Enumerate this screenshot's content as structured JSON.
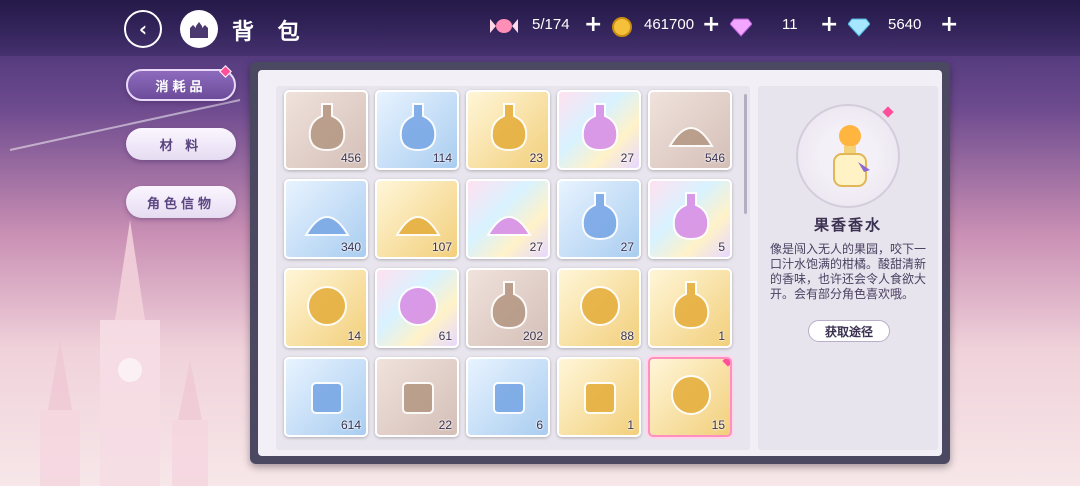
{
  "header": {
    "title": "背 包",
    "back_icon": "back-arrow-icon",
    "home_icon": "castle-icon"
  },
  "resources": [
    {
      "name": "candy",
      "icon": "candy-icon",
      "value": "5/174"
    },
    {
      "name": "coin",
      "icon": "gold-coin-icon",
      "value": "461700"
    },
    {
      "name": "pink-gem",
      "icon": "pink-diamond-icon",
      "value": "11"
    },
    {
      "name": "blue-gem",
      "icon": "blue-diamond-icon",
      "value": "5640"
    }
  ],
  "tabs": [
    {
      "label": "消耗品",
      "active": true
    },
    {
      "label": "材 料",
      "active": false
    },
    {
      "label": "角色信物",
      "active": false
    }
  ],
  "items": [
    {
      "icon": "green-potion-vial-icon",
      "count": "456",
      "rarity": "brown"
    },
    {
      "icon": "purple-sparkle-flask-icon",
      "count": "114",
      "rarity": "blue"
    },
    {
      "icon": "gold-potion-bottle-icon",
      "count": "23",
      "rarity": "gold"
    },
    {
      "icon": "rainbow-potion-bottle-icon",
      "count": "27",
      "rarity": "rainbow"
    },
    {
      "icon": "sand-pile-icon",
      "count": "546",
      "rarity": "brown"
    },
    {
      "icon": "white-powder-pile-icon",
      "count": "340",
      "rarity": "blue"
    },
    {
      "icon": "gold-powder-pile-icon",
      "count": "107",
      "rarity": "gold"
    },
    {
      "icon": "rainbow-powder-pile-icon",
      "count": "27",
      "rarity": "rainbow"
    },
    {
      "icon": "blue-potion-bottle-icon",
      "count": "27",
      "rarity": "blue"
    },
    {
      "icon": "ornate-blue-bottle-icon",
      "count": "5",
      "rarity": "rainbow"
    },
    {
      "icon": "golden-trophy-icon",
      "count": "14",
      "rarity": "gold"
    },
    {
      "icon": "crystal-globe-icon",
      "count": "61",
      "rarity": "rainbow"
    },
    {
      "icon": "pink-potion-bottle-icon",
      "count": "202",
      "rarity": "brown"
    },
    {
      "icon": "flower-jar-icon",
      "count": "88",
      "rarity": "gold"
    },
    {
      "icon": "orange-perfume-icon",
      "count": "1",
      "rarity": "gold"
    },
    {
      "icon": "single-can-icon",
      "count": "614",
      "rarity": "blue"
    },
    {
      "icon": "three-cans-icon",
      "count": "22",
      "rarity": "brown"
    },
    {
      "icon": "stacked-cans-icon",
      "count": "6",
      "rarity": "blue"
    },
    {
      "icon": "can-gift-box-icon",
      "count": "1",
      "rarity": "gold"
    },
    {
      "icon": "gift-bag-icon",
      "count": "15",
      "rarity": "gold",
      "selected": true
    }
  ],
  "detail": {
    "name": "果香香水",
    "icon": "orange-perfume-icon",
    "description": "像是闯入无人的果园，咬下一口汁水饱满的柑橘。酸甜清新的香味，也许还会令人食欲大开。会有部分角色喜欢哦。",
    "source_button": "获取途径"
  }
}
